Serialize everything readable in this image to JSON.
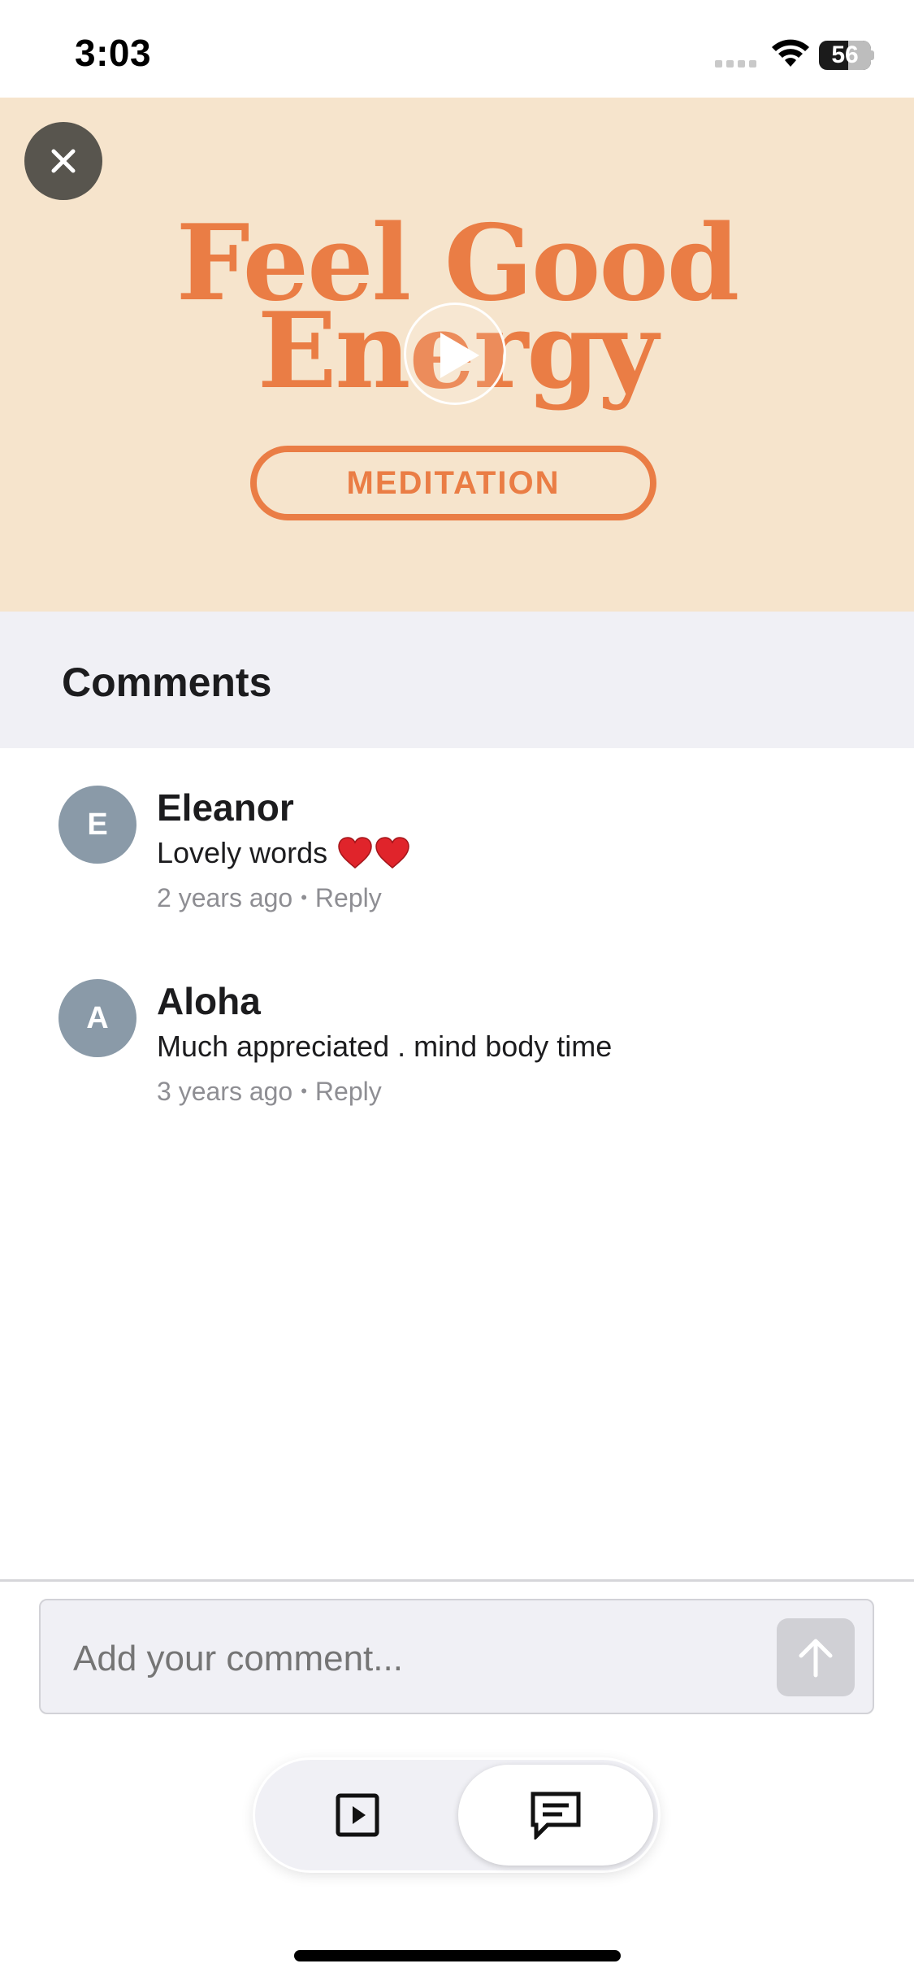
{
  "status_bar": {
    "time": "3:03",
    "battery": "56"
  },
  "hero": {
    "title_line1": "Feel Good",
    "title_line2": "Energy",
    "pill": "MEDITATION",
    "bg_color": "#f6e4cc",
    "accent_color": "#ea7d45"
  },
  "comments": {
    "title": "Comments",
    "items": [
      {
        "initial": "E",
        "name": "Eleanor",
        "text": "Lovely words",
        "hearts": 2,
        "age": "2 years ago",
        "reply": "Reply"
      },
      {
        "initial": "A",
        "name": "Aloha",
        "text": "Much appreciated . mind body time",
        "hearts": 0,
        "age": "3 years ago",
        "reply": "Reply"
      }
    ]
  },
  "composer": {
    "placeholder": "Add your comment..."
  },
  "toggle": {
    "options": [
      "video-icon",
      "comments-icon"
    ],
    "selected": "comments"
  }
}
